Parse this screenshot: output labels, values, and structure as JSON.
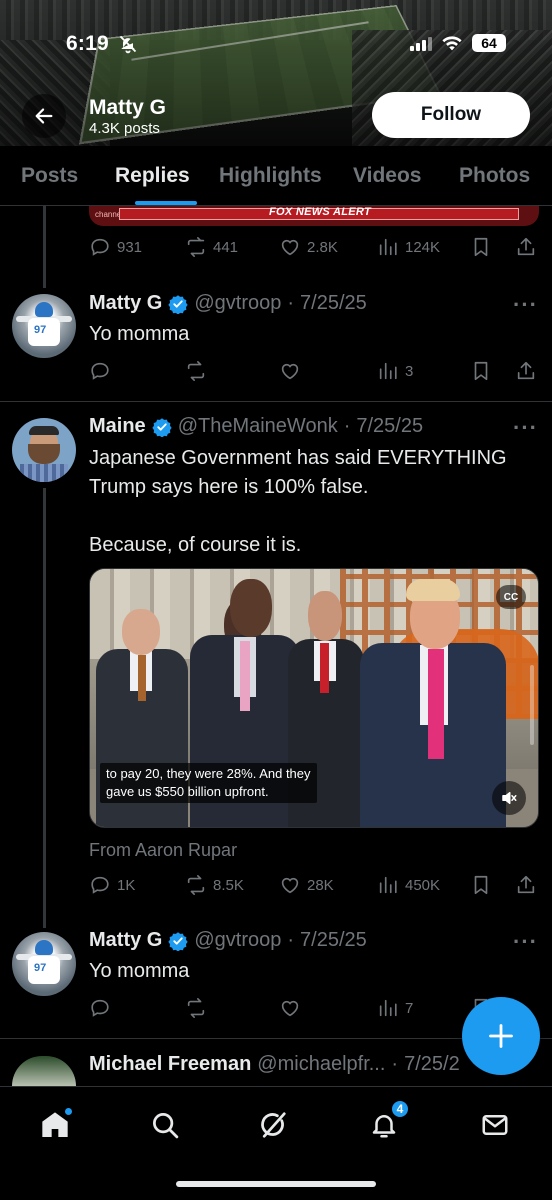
{
  "status_bar": {
    "time": "6:19",
    "battery": "64"
  },
  "header": {
    "name": "Matty G",
    "posts": "4.3K posts",
    "follow_label": "Follow"
  },
  "tabs": [
    {
      "label": "Posts",
      "active": false
    },
    {
      "label": "Replies",
      "active": true
    },
    {
      "label": "Highlights",
      "active": false
    },
    {
      "label": "Videos",
      "active": false
    },
    {
      "label": "Photos",
      "active": false
    }
  ],
  "clipped_post": {
    "media_banner": "FOX NEWS ALERT",
    "media_channel": "channel",
    "stats": {
      "replies": "931",
      "reposts": "441",
      "likes": "2.8K",
      "views": "124K"
    }
  },
  "posts": [
    {
      "name": "Matty G",
      "verified": true,
      "handle": "@gvtroop",
      "date": "7/25/25",
      "text": "Yo momma",
      "stats": {
        "replies": "",
        "reposts": "",
        "likes": "",
        "views": "3"
      }
    },
    {
      "name": "Maine",
      "verified": true,
      "handle": "@TheMaineWonk",
      "date": "7/25/25",
      "text": "Japanese Government has said EVERYTHING Trump says here is 100% false.\n\nBecause, of course it is.",
      "video": {
        "caption": "to pay 20, they were 28%. And they\ngave us $550 billion upfront.",
        "cc_label": "CC"
      },
      "from": "From Aaron Rupar",
      "stats": {
        "replies": "1K",
        "reposts": "8.5K",
        "likes": "28K",
        "views": "450K"
      }
    },
    {
      "name": "Matty G",
      "verified": true,
      "handle": "@gvtroop",
      "date": "7/25/25",
      "text": "Yo momma",
      "stats": {
        "replies": "",
        "reposts": "",
        "likes": "",
        "views": "7"
      }
    },
    {
      "name": "Michael Freeman",
      "verified": false,
      "handle": "@michaelpfr...",
      "date": "7/25/2"
    }
  ],
  "bottom_nav": {
    "items": [
      "home-icon",
      "search-icon",
      "grok-icon",
      "notifications-icon",
      "messages-icon"
    ],
    "notifications_badge": "4"
  },
  "colors": {
    "accent": "#1d9bf0",
    "background": "#000000",
    "muted": "#71767b",
    "text": "#e7e9ea"
  }
}
